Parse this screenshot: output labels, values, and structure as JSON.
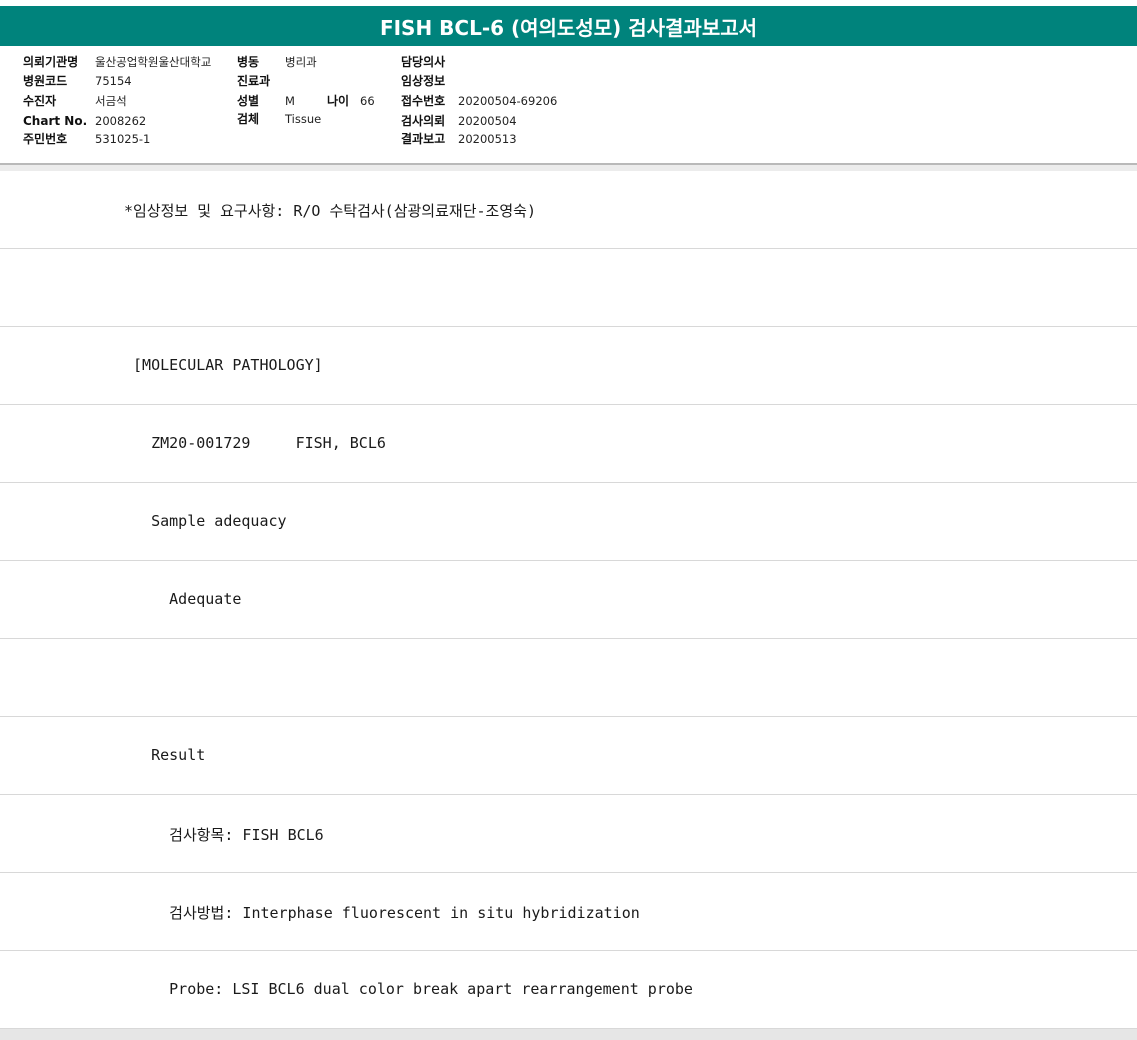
{
  "title": "FISH BCL-6 (여의도성모) 검사결과보고서",
  "info": {
    "labels": {
      "hospital": "의뢰기관명",
      "hospital_code": "병원코드",
      "patient": "수진자",
      "chart_no": "Chart No.",
      "resident_no": "주민번호",
      "ward": "병동",
      "department": "진료과",
      "sex": "성별",
      "age": "나이",
      "specimen": "검체",
      "doctor": "담당의사",
      "clinical_info": "임상정보",
      "accession_no": "접수번호",
      "request_date": "검사의뢰",
      "report_date": "결과보고"
    },
    "values": {
      "hospital": "울산공업학원울산대학교",
      "hospital_code": "75154",
      "patient": "서금석",
      "chart_no": "2008262",
      "resident_no": "531025-1",
      "ward": "병리과",
      "department": "",
      "sex": "M",
      "age": "66",
      "specimen": "Tissue",
      "doctor": "",
      "clinical_info": "",
      "accession_no": "20200504-69206",
      "request_date": "20200504",
      "report_date": "20200513"
    }
  },
  "report_lines": [
    "*임상정보 및 요구사항: R/O 수탁검사(삼광의료재단-조영숙)",
    "",
    " [MOLECULAR PATHOLOGY]",
    "   ZM20-001729     FISH, BCL6",
    "   Sample adequacy",
    "     Adequate",
    "",
    "   Result",
    "     검사항목: FISH BCL6",
    "     검사방법: Interphase fluorescent in situ hybridization",
    "     Probe: LSI BCL6 dual color break apart rearrangement probe"
  ]
}
